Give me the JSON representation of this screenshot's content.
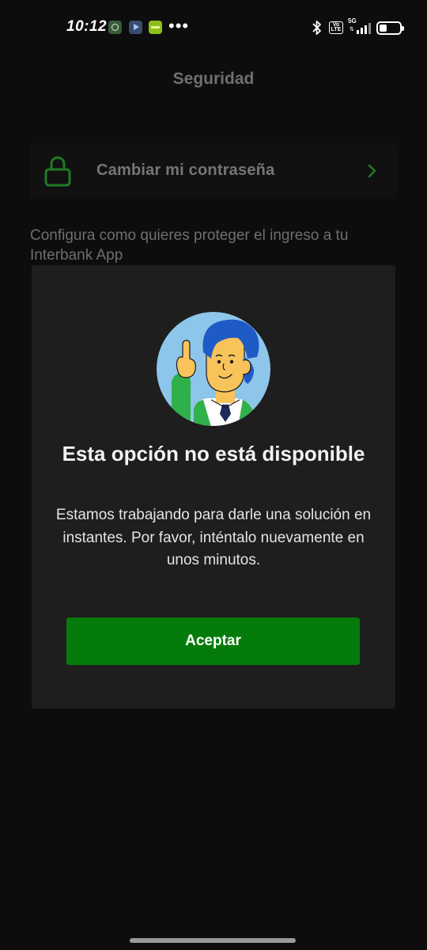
{
  "status_bar": {
    "time": "10:12",
    "notification_icons": [
      "whatsapp-icon",
      "play-icon",
      "store-icon"
    ],
    "more_indicator": "•••",
    "network": "5G",
    "volte": "Vo LTE",
    "battery_percent": 25
  },
  "header": {
    "title": "Seguridad"
  },
  "change_password": {
    "icon": "lock-icon",
    "label": "Cambiar mi contraseña",
    "chevron": "chevron-right-icon"
  },
  "description": "Configura como quieres proteger el ingreso a tu Interbank App",
  "modal": {
    "illustration": "person-pointing-illustration",
    "title": "Esta opción no está disponible",
    "body": "Estamos trabajando para darle una solución en instantes. Por favor, inténtalo nuevamente en unos minutos.",
    "accept_label": "Aceptar"
  },
  "colors": {
    "background": "#0d0d0d",
    "modal": "#1e1e1e",
    "accent_green": "#057b0b",
    "lock_green": "#1f7a25"
  }
}
